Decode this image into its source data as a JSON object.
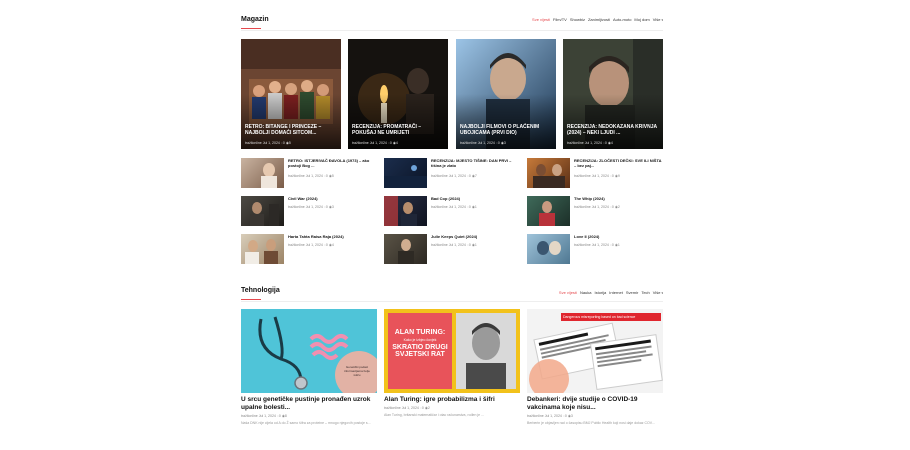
{
  "magazin": {
    "title": "Magazin",
    "filters": [
      "Sve vijesti",
      "Film/TV",
      "Showbiz",
      "Zanimljivosti",
      "Auto-moto",
      "Moj dom",
      "Više"
    ],
    "featured": [
      {
        "title": "RETRO: BITANGE I PRINCEZE – najbolji domaći sitcom...",
        "author": "tražilonline",
        "date": "Jul 1, 2024",
        "comments": "0",
        "views": "5"
      },
      {
        "title": "RECENZIJA: PROMATRAČI – pokušaj ne umrijeti",
        "author": "tražilonline",
        "date": "Jul 1, 2024",
        "comments": "0",
        "views": "4"
      },
      {
        "title": "NAJBOLJI FILMOVI O PLAĆENIM UBOJICAMA (prvi dio)",
        "author": "tražilonline",
        "date": "Jul 1, 2024",
        "comments": "0",
        "views": "3"
      },
      {
        "title": "RECENZIJA: NEDOKAZANA KRIVNJA (2024) – neki ljudi ...",
        "author": "tražilonline",
        "date": "Jul 1, 2024",
        "comments": "0",
        "views": "4"
      }
    ],
    "list": [
      {
        "title": "RETRO: ISTJERIVAČ ĐAVOLA (1973) – ako postoji Bog ...",
        "author": "tražilonline",
        "date": "Jul 1, 2024",
        "comments": "0",
        "views": "5"
      },
      {
        "title": "RECENZIJA: MJESTO TIŠINE: DAN PRVI – tišina je zlato",
        "author": "tražilonline",
        "date": "Jul 1, 2024",
        "comments": "0",
        "views": "7"
      },
      {
        "title": "RECENZIJA: ZLOČESTI DEČKI: SVE ILI NIŠTA – bez paj...",
        "author": "tražilonline",
        "date": "Jul 1, 2024",
        "comments": "0",
        "views": "9"
      },
      {
        "title": "Civil War (2024)",
        "author": "tražilonline",
        "date": "Jul 1, 2024",
        "comments": "0",
        "views": "3"
      },
      {
        "title": "Bad Cop (2024)",
        "author": "tražilonline",
        "date": "Jul 1, 2024",
        "comments": "0",
        "views": "1"
      },
      {
        "title": "The Whip (2024)",
        "author": "tražilonline",
        "date": "Jul 1, 2024",
        "comments": "0",
        "views": "2"
      },
      {
        "title": "Harta Tahta Raisa Raja (2024)",
        "author": "tražilonline",
        "date": "Jul 1, 2024",
        "comments": "0",
        "views": "4"
      },
      {
        "title": "Julie Keeps Quiet (2024)",
        "author": "tražilonline",
        "date": "Jul 1, 2024",
        "comments": "0",
        "views": "1"
      },
      {
        "title": "Love II (2024)",
        "author": "tražilonline",
        "date": "Jul 1, 2024",
        "comments": "0",
        "views": "1"
      }
    ]
  },
  "tehnologija": {
    "title": "Tehnologija",
    "filters": [
      "Sve vijesti",
      "Nauka",
      "Istorija",
      "Internet",
      "Svemir",
      "Tech",
      "Više"
    ],
    "cards": [
      {
        "title": "U srcu genetičke pustinje pronađen uzrok upalne bolesti...",
        "author": "tražilonline",
        "date": "Jul 1, 2024",
        "comments": "0",
        "views": "8",
        "excerpt": "Naša DNK nije cijela od A do Ž samo šifra za proteine – mnogo njegovih postoje s..."
      },
      {
        "title": "Alan Turing: igre probabilizma i šifri",
        "author": "tražilonline",
        "date": "Jul 1, 2024",
        "comments": "0",
        "views": "2",
        "excerpt": "Alan Turing, britanski matematičar i otac računarstva, rođen je ...",
        "img_lines": [
          "ALAN TURING:",
          "Kako je izbjeo čovjek",
          "SKRATIO DRUGI",
          "SVJETSKI RAT"
        ]
      },
      {
        "title": "Debankeri: dvije studije o COVID-19 vakcinama koje nisu...",
        "author": "tražilonline",
        "date": "Jul 1, 2024",
        "comments": "0",
        "views": "3",
        "excerpt": "Berberin je objavljen rad o časopisu BMJ Public Health koji nosi daje dokaz COV...",
        "img_banner": "Dangerous misreporting based on bad science"
      }
    ],
    "sticker": [
      "Genetički podaci",
      "informacijama bolje",
      "ističu"
    ]
  },
  "colors": {
    "accent": "#e5484d",
    "meta": "#888888"
  },
  "icons": {
    "comment": "comment-icon",
    "eye": "eye-icon",
    "caret": "caret-down-icon"
  }
}
